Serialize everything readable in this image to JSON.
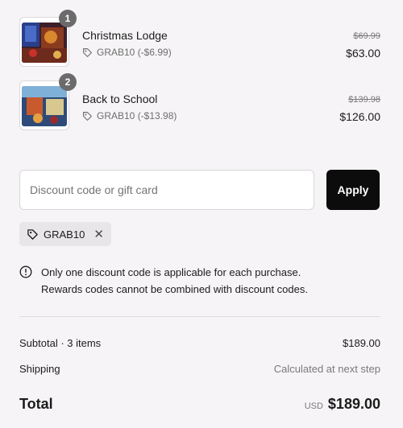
{
  "items": [
    {
      "qty": "1",
      "name": "Christmas Lodge",
      "discount": "GRAB10 (-$6.99)",
      "old_price": "$69.99",
      "price": "$63.00"
    },
    {
      "qty": "2",
      "name": "Back to School",
      "discount": "GRAB10 (-$13.98)",
      "old_price": "$139.98",
      "price": "$126.00"
    }
  ],
  "discount_field": {
    "placeholder": "Discount code or gift card"
  },
  "apply_label": "Apply",
  "applied_code": "GRAB10",
  "remove_glyph": "✕",
  "notice": {
    "line1": "Only one discount code is applicable for each purchase.",
    "line2": "Rewards codes cannot be combined with discount codes."
  },
  "summary": {
    "subtotal_label": "Subtotal · 3 items",
    "subtotal_value": "$189.00",
    "shipping_label": "Shipping",
    "shipping_value": "Calculated at next step",
    "total_label": "Total",
    "currency": "USD",
    "total_value": "$189.00"
  },
  "icons": [
    "tag-icon",
    "info-icon",
    "close-icon"
  ],
  "colors": {
    "button": "#0c0c0c",
    "background": "#f6f4f6",
    "badge": "#6b6b6b"
  }
}
